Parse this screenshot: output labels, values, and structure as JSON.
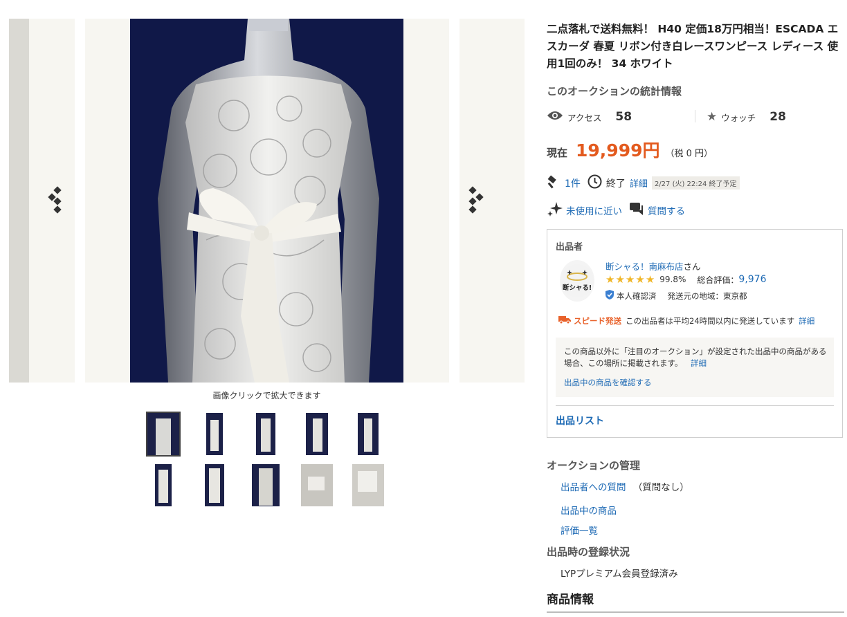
{
  "gallery": {
    "zoom_note": "画像クリックで拡大できます",
    "thumbnails": [
      "thumb-1",
      "thumb-2",
      "thumb-3",
      "thumb-4",
      "thumb-5",
      "thumb-6",
      "thumb-7",
      "thumb-8",
      "thumb-9",
      "thumb-10"
    ]
  },
  "listing": {
    "title": "二点落札で送料無料！ H40 定価18万円相当！ESCADA エスカーダ 春夏 リボン付き白レースワンピース レディース 使用1回のみ！ 34 ホワイト"
  },
  "stats": {
    "heading": "このオークションの統計情報",
    "access_label": "アクセス",
    "access_value": "58",
    "watch_label": "ウォッチ",
    "watch_value": "28"
  },
  "price": {
    "label": "現在",
    "value": "19,999円",
    "tax": "（税 0 円）"
  },
  "bid": {
    "count": "1件",
    "end_label": "終了",
    "detail": "詳細",
    "end_time": "2/27 (火) 22:24 終了予定"
  },
  "condition": {
    "label": "未使用に近い",
    "question": "質問する"
  },
  "seller": {
    "heading": "出品者",
    "avatar_text": "断シャる!",
    "name": "断シャる！南麻布店",
    "honorific": "さん",
    "rating_percent": "99.8%",
    "total_label": "総合評価：",
    "total_value": "9,976",
    "verified": "本人確認済",
    "ship_from": "発送元の地域：東京都",
    "speed_badge": "スピード発送",
    "speed_text": "この出品者は平均24時間以内に発送しています",
    "speed_detail": "詳細",
    "notice_text": "この商品以外に「注目のオークション」が設定された出品中の商品がある場合、この場所に掲載されます。",
    "notice_detail": "詳細",
    "notice_link": "出品中の商品を確認する",
    "list_link": "出品リスト"
  },
  "management": {
    "heading": "オークションの管理",
    "q_link": "出品者への質問",
    "q_note": "（質問なし）",
    "items_link": "出品中の商品",
    "ratings_link": "評価一覧"
  },
  "registration": {
    "heading": "出品時の登録状況",
    "value": "LYPプレミアム会員登録済み"
  },
  "product_info": {
    "heading": "商品情報"
  },
  "colors": {
    "price": "#e35a1e",
    "link": "#1f6bb5",
    "star": "#f0b627",
    "photo_bg": "#111a4c"
  }
}
